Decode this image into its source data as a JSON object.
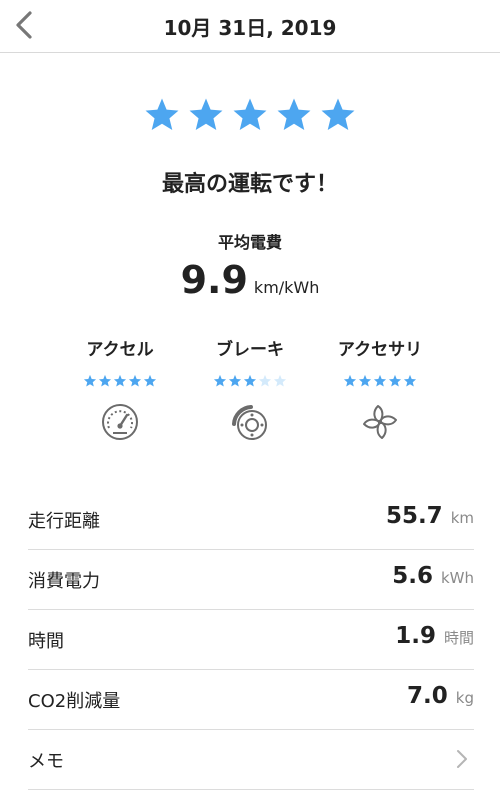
{
  "header": {
    "title": "10月 31日, 2019",
    "back_icon": "chevron-left-icon"
  },
  "overall": {
    "rating": 5,
    "max_rating": 5,
    "headline": "最高の運転です！",
    "star_color": "#4da6f0"
  },
  "efficiency": {
    "label": "平均電費",
    "value": "9.9",
    "unit": "km/kWh"
  },
  "categories": [
    {
      "label": "アクセル",
      "rating": 5,
      "max": 5,
      "icon": "speedometer-icon"
    },
    {
      "label": "ブレーキ",
      "rating": 3,
      "max": 5,
      "icon": "brake-disc-icon"
    },
    {
      "label": "アクセサリ",
      "rating": 5,
      "max": 5,
      "icon": "fan-icon"
    }
  ],
  "stats": [
    {
      "label": "走行距離",
      "value": "55.7",
      "unit": "km"
    },
    {
      "label": "消費電力",
      "value": "5.6",
      "unit": "kWh"
    },
    {
      "label": "時間",
      "value": "1.9",
      "unit": "時間"
    },
    {
      "label": "CO2削減量",
      "value": "7.0",
      "unit": "kg"
    }
  ],
  "memo": {
    "label": "メモ",
    "icon": "chevron-right-icon"
  },
  "colors": {
    "star_active": "#4da6f0",
    "star_inactive": "#d4eafb",
    "icon_gray": "#6b6b6b",
    "divider": "#dcdcdc"
  }
}
